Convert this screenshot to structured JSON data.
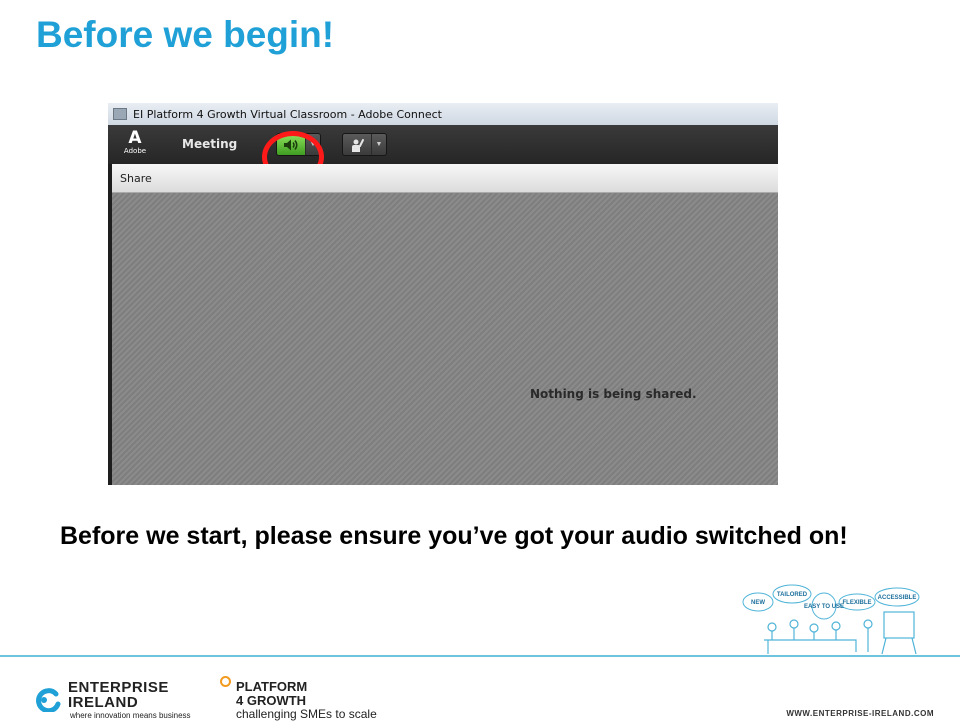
{
  "slide": {
    "title": "Before we begin!",
    "instruction": "Before we start, please ensure you’ve got your audio switched on!"
  },
  "screenshot": {
    "window_title": "EI Platform 4 Growth Virtual Classroom - Adobe Connect",
    "adobe_logo_letter": "A",
    "adobe_logo_text": "Adobe",
    "menu_meeting": "Meeting",
    "audio_button_icon": "speaker-icon",
    "status_button_icon": "raise-hand-icon",
    "dropdown_glyph": "▼",
    "highlight_color": "#ff1a1a",
    "pod_title": "Share",
    "pod_empty_message": "Nothing is being shared."
  },
  "illustration": {
    "bubbles": [
      "NEW",
      "TAILORED",
      "EASY TO USE",
      "FLEXIBLE",
      "ACCESSIBLE"
    ]
  },
  "footer": {
    "ei_name_line1": "ENTERPRISE",
    "ei_name_line2": "IRELAND",
    "ei_tagline": "where innovation means business",
    "p4g_name_line1": "PLATFORM",
    "p4g_name_line2": "4 GROWTH",
    "p4g_tagline": "challenging SMEs to scale",
    "website": "WWW.ENTERPRISE-IRELAND.COM"
  },
  "colors": {
    "title_blue": "#1fa0d6",
    "footer_line": "#6ec4de",
    "audio_green": "#5cc132",
    "p4g_orange": "#f39a1f"
  }
}
